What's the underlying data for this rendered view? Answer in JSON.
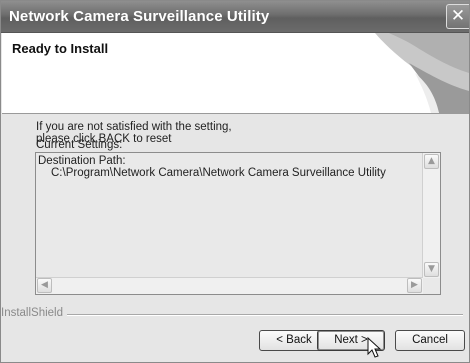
{
  "window": {
    "title": "Network Camera Surveillance Utility",
    "close_glyph": "✕"
  },
  "header": {
    "title": "Ready to Install"
  },
  "body": {
    "line1": "If you are not satisfied with the setting,",
    "line2": "please click BACK to reset"
  },
  "settings": {
    "label": "Current Settings:",
    "path_label": "Destination Path:",
    "path_value": "C:\\Program\\Network Camera\\Network Camera Surveillance Utility"
  },
  "scrollbar_icons": {
    "up": "up-arrow-icon",
    "down": "down-arrow-icon",
    "left": "left-arrow-icon",
    "right": "right-arrow-icon"
  },
  "footer": {
    "brand": "InstallShield",
    "back_label": "< Back",
    "next_label": "Next >",
    "cancel_label": "Cancel"
  }
}
